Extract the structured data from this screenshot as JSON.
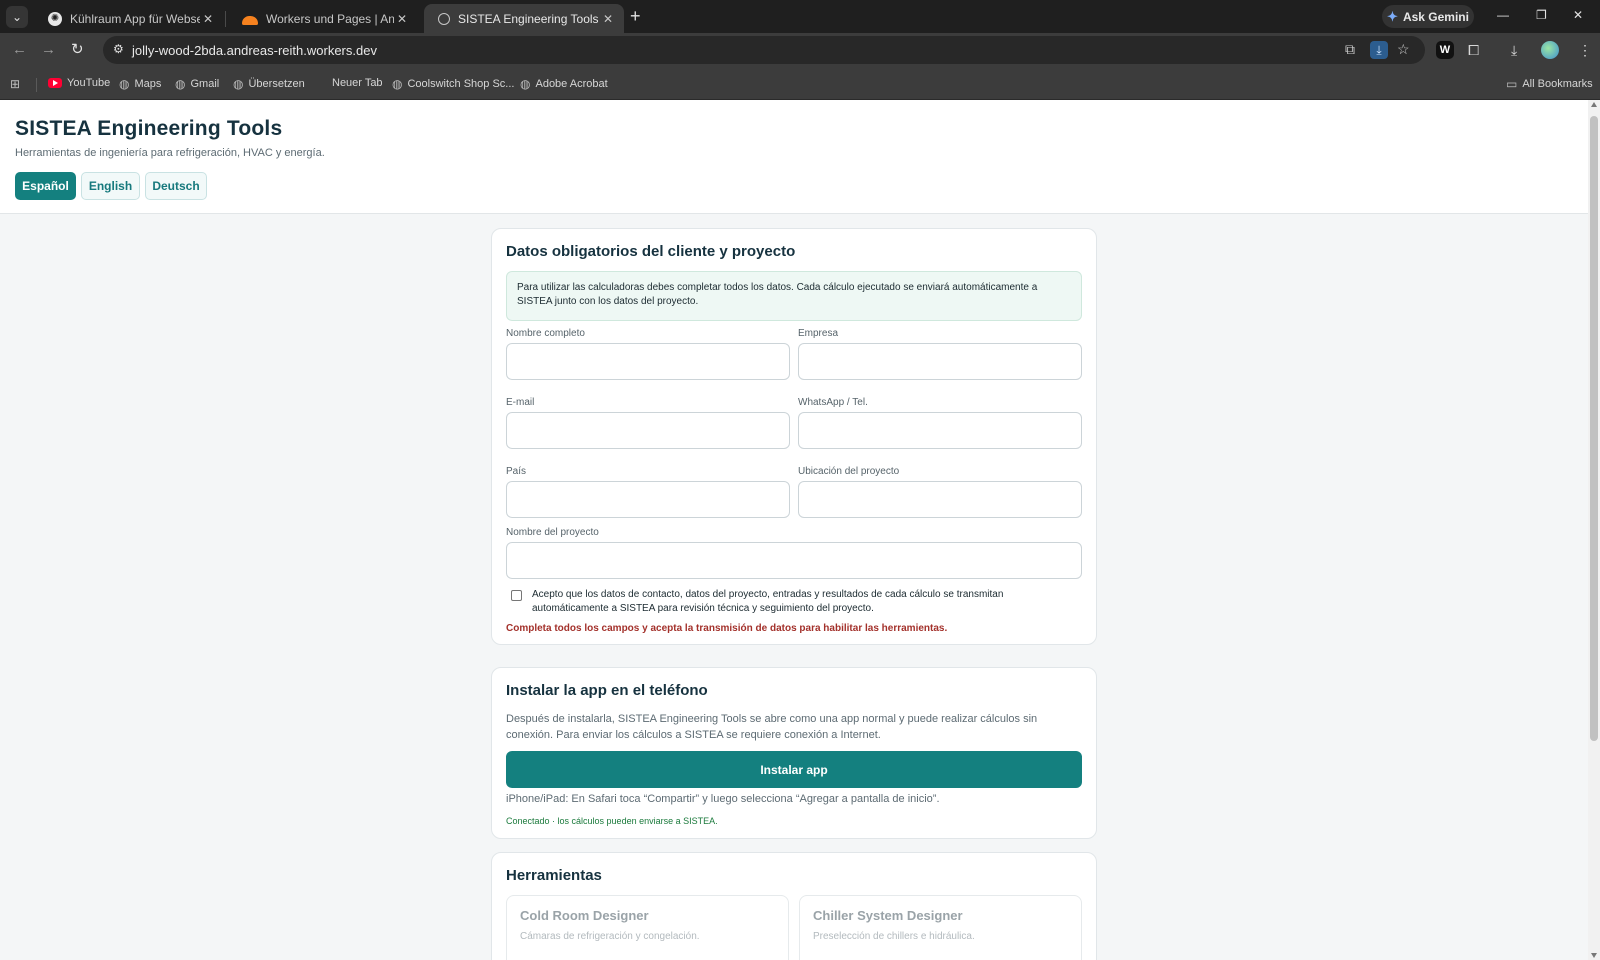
{
  "browser": {
    "tabs": [
      {
        "title": "Kühlraum App für Webseite",
        "favicon": "chatgpt-icon",
        "active": false
      },
      {
        "title": "Workers und Pages | Andreas.reith",
        "favicon": "cloudflare-icon",
        "active": false
      },
      {
        "title": "SISTEA Engineering Tools",
        "favicon": "globe-icon",
        "active": true
      }
    ],
    "ask_gemini": "Ask Gemini",
    "url": "jolly-wood-2bda.andreas-reith.workers.dev",
    "bookmarks": [
      "YouTube",
      "Maps",
      "Gmail",
      "Übersetzen",
      "Neuer Tab",
      "Coolswitch Shop Sc...",
      "Adobe Acrobat"
    ],
    "all_bookmarks": "All Bookmarks",
    "ext_w_label": "W"
  },
  "header": {
    "title": "SISTEA Engineering Tools",
    "subtitle": "Herramientas de ingeniería para refrigeración, HVAC y energía.",
    "languages": [
      "Español",
      "English",
      "Deutsch"
    ],
    "active_language": "Español"
  },
  "client_form": {
    "title": "Datos obligatorios del cliente y proyecto",
    "notice": "Para utilizar las calculadoras debes completar todos los datos. Cada cálculo ejecutado se enviará automáticamente a SISTEA junto con los datos del proyecto.",
    "fields": {
      "full_name": {
        "label": "Nombre completo",
        "value": ""
      },
      "company": {
        "label": "Empresa",
        "value": ""
      },
      "email": {
        "label": "E-mail",
        "value": ""
      },
      "phone": {
        "label": "WhatsApp / Tel.",
        "value": ""
      },
      "country": {
        "label": "País",
        "value": ""
      },
      "location": {
        "label": "Ubicación del proyecto",
        "value": ""
      },
      "project_name": {
        "label": "Nombre del proyecto",
        "value": ""
      }
    },
    "consent": "Acepto que los datos de contacto, datos del proyecto, entradas y resultados de cada cálculo se transmitan automáticamente a SISTEA para revisión técnica y seguimiento del proyecto.",
    "consent_checked": false,
    "warning": "Completa todos los campos y acepta la transmisión de datos para habilitar las herramientas."
  },
  "install": {
    "title": "Instalar la app en el teléfono",
    "description": "Después de instalarla, SISTEA Engineering Tools se abre como una app normal y puede realizar cálculos sin conexión. Para enviar los cálculos a SISTEA se requiere conexión a Internet.",
    "button": "Instalar app",
    "ios_hint": "iPhone/iPad: En Safari toca “Compartir” y luego selecciona “Agregar a pantalla de inicio”.",
    "status": "Conectado · los cálculos pueden enviarse a SISTEA."
  },
  "tools": {
    "title": "Herramientas",
    "items": [
      {
        "name": "Cold Room Designer",
        "description": "Cámaras de refrigeración y congelación."
      },
      {
        "name": "Chiller System Designer",
        "description": "Preselección de chillers e hidráulica."
      }
    ]
  },
  "colors": {
    "accent": "#14807f",
    "warning": "#a3312b",
    "status_ok": "#1b7a3c",
    "heading": "#16323f"
  }
}
